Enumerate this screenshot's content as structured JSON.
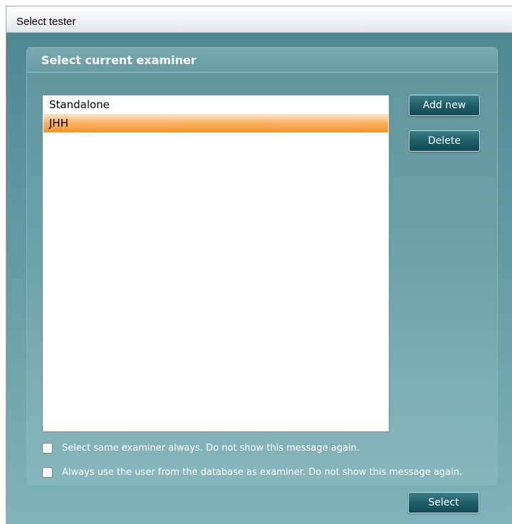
{
  "window": {
    "title": "Select tester"
  },
  "panel": {
    "title": "Select current examiner"
  },
  "examiners": [
    {
      "label": "Standalone",
      "selected": false
    },
    {
      "label": "JHH",
      "selected": true
    }
  ],
  "buttons": {
    "add_new": "Add new",
    "delete": "Delete",
    "select": "Select"
  },
  "options": {
    "same_examiner": {
      "label": "Select same examiner always. Do not show this message again.",
      "checked": false
    },
    "database_user": {
      "label": "Always use the user from the database as examiner. Do not show this message again.",
      "checked": false
    }
  },
  "colors": {
    "accent_selection": "#f7941d",
    "button_dark": "#1f5e68",
    "panel_teal": "#6fa3ab"
  }
}
